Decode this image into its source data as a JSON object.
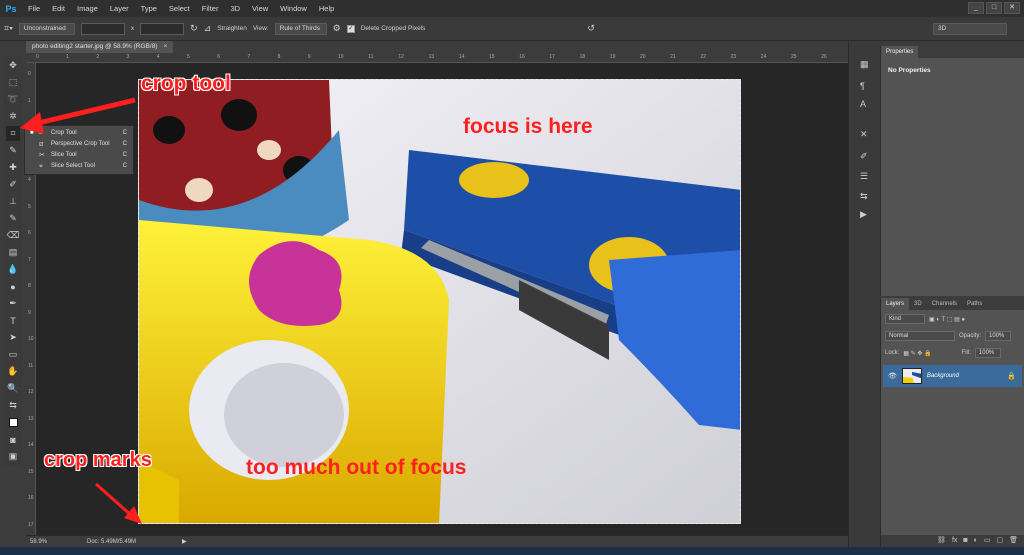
{
  "app": {
    "logo": "Ps",
    "menu": [
      "File",
      "Edit",
      "Image",
      "Layer",
      "Type",
      "Select",
      "Filter",
      "3D",
      "View",
      "Window",
      "Help"
    ],
    "window_controls": [
      "_",
      "□",
      "✕"
    ]
  },
  "options_bar": {
    "ratio": "Unconstrained",
    "ratio_swap": "x",
    "straighten_label": "Straighten",
    "view_label": "View:",
    "view_value": "Rule of Thirds",
    "delete_cropped_label": "Delete Cropped Pixels",
    "delete_cropped_checked": true,
    "workspace": "3D"
  },
  "document": {
    "tab_title": "photo editing2 starter.jpg @ 58.9% (RGB/8)",
    "tab_close": "×"
  },
  "rulers": {
    "top_ticks": [
      "0",
      "1",
      "2",
      "3",
      "4",
      "5",
      "6",
      "7",
      "8",
      "9",
      "10",
      "11",
      "12",
      "13",
      "14",
      "15",
      "16",
      "17",
      "18",
      "19",
      "20",
      "21",
      "22",
      "23",
      "24",
      "25",
      "26"
    ],
    "left_ticks": [
      "0",
      "1",
      "2",
      "3",
      "4",
      "5",
      "6",
      "7",
      "8",
      "9",
      "10",
      "11",
      "12",
      "13",
      "14",
      "15",
      "16",
      "17"
    ]
  },
  "tool_flyout": {
    "items": [
      {
        "label": "Crop Tool",
        "key": "C",
        "selected": true
      },
      {
        "label": "Perspective Crop Tool",
        "key": "C",
        "selected": false
      },
      {
        "label": "Slice Tool",
        "key": "C",
        "selected": false
      },
      {
        "label": "Slice Select Tool",
        "key": "C",
        "selected": false
      }
    ]
  },
  "status": {
    "zoom": "58.9%",
    "doc_size": "Doc: 5.49M/5.49M"
  },
  "properties_panel": {
    "tab": "Properties",
    "empty_text": "No Properties"
  },
  "layers_panel": {
    "tabs": [
      "Layers",
      "3D",
      "Channels",
      "Paths"
    ],
    "filter_kind": "Kind",
    "blend_mode": "Normal",
    "opacity_label": "Opacity:",
    "opacity_value": "100%",
    "lock_label": "Lock:",
    "fill_label": "Fill:",
    "fill_value": "100%",
    "layers": [
      {
        "name": "Background"
      }
    ]
  },
  "annotations": {
    "crop_tool": "crop tool",
    "focus": "focus is here",
    "crop_marks": "crop marks",
    "out_of_focus": "too much out of focus"
  },
  "colors": {
    "annotation": "#ff1f1f",
    "layer_selected": "#3a6b9b",
    "toy_yellow": "#f5d800"
  }
}
